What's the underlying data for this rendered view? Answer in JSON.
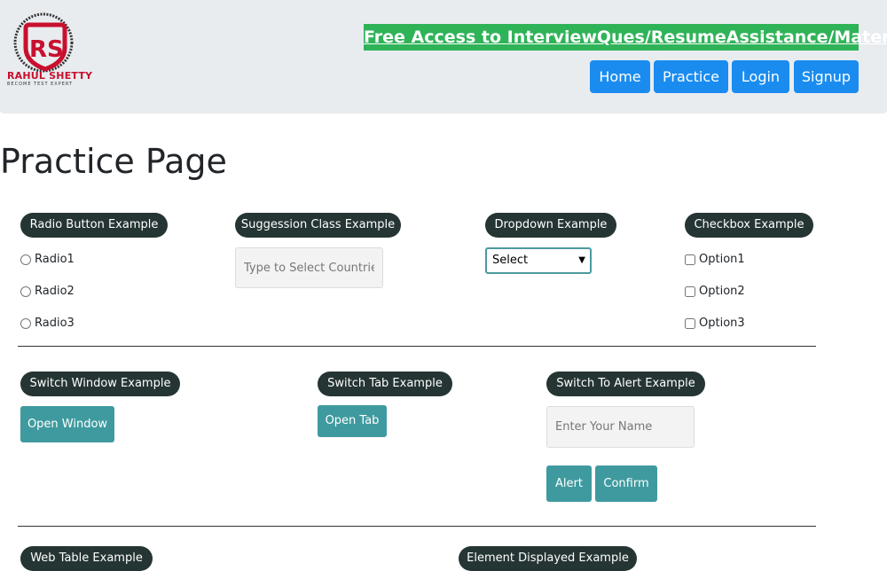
{
  "header": {
    "logo_text": "RAHUL SHETTY",
    "logo_sub": "BECOME TEST EXPERT",
    "free_access": "Free Access to InterviewQues/ResumeAssistance/Material",
    "nav": [
      "Home",
      "Practice",
      "Login",
      "Signup"
    ]
  },
  "page_title": "Practice Page",
  "radio": {
    "legend": "Radio Button Example",
    "options": [
      "Radio1",
      "Radio2",
      "Radio3"
    ]
  },
  "suggestion": {
    "legend": "Suggession Class Example",
    "placeholder": "Type to Select Countries"
  },
  "dropdown": {
    "legend": "Dropdown Example",
    "selected": "Select"
  },
  "checkbox": {
    "legend": "Checkbox Example",
    "options": [
      "Option1",
      "Option2",
      "Option3"
    ]
  },
  "switch_window": {
    "legend": "Switch Window Example",
    "button": "Open Window"
  },
  "switch_tab": {
    "legend": "Switch Tab Example",
    "button": "Open Tab"
  },
  "alert": {
    "legend": "Switch To Alert Example",
    "placeholder": "Enter Your Name",
    "alert_button": "Alert",
    "confirm_button": "Confirm"
  },
  "web_table": {
    "legend": "Web Table Example"
  },
  "element_displayed": {
    "legend": "Element Displayed Example"
  }
}
